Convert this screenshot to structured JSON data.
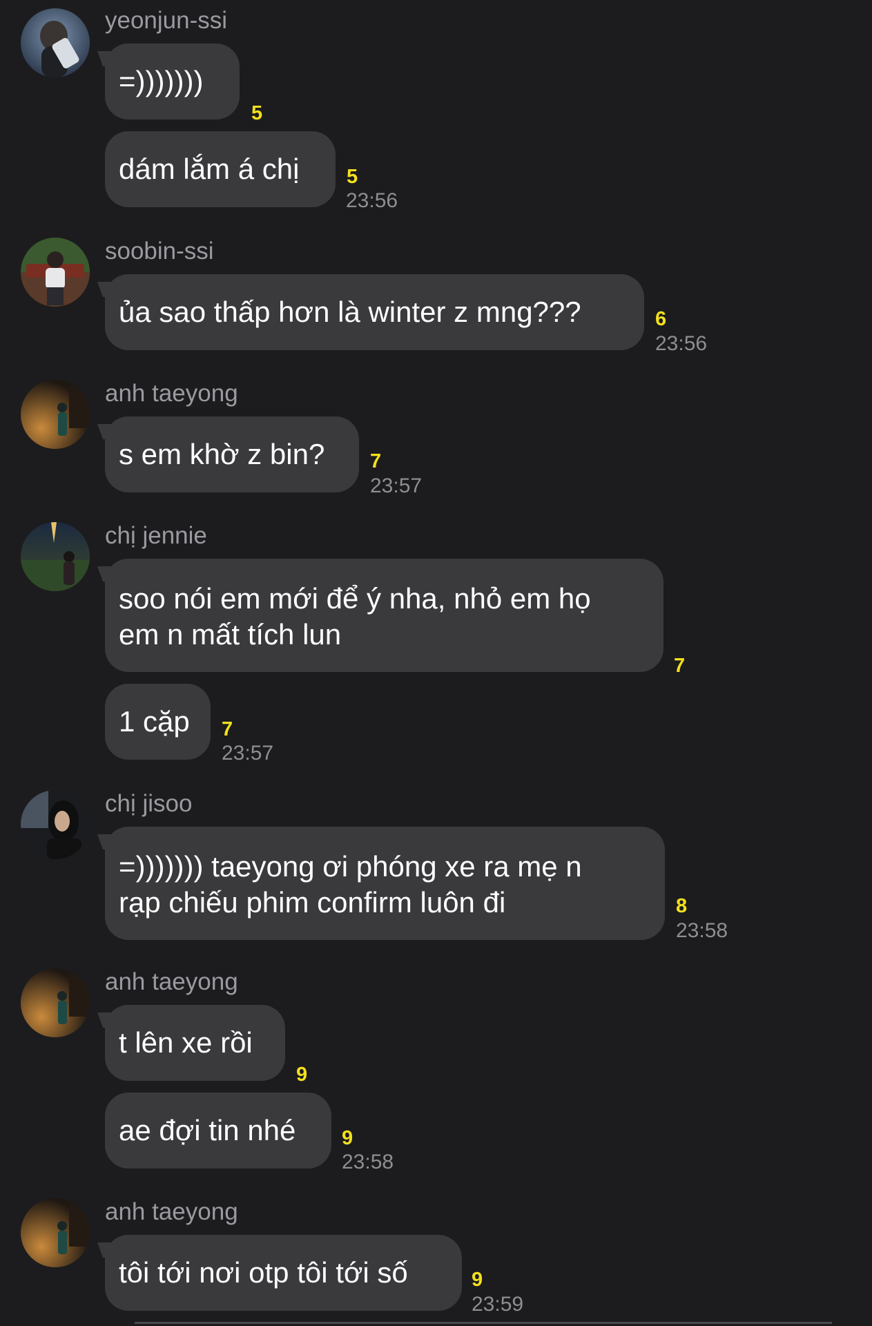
{
  "colors": {
    "background": "#1c1c1e",
    "bubble": "#3a3a3d",
    "read_count": "#f2e01e",
    "time": "#8e8e93",
    "sender": "#9a9aa0"
  },
  "messages": [
    {
      "sender": "yeonjun-ssi",
      "avatar": "avatar-yeonjun",
      "bubbles": [
        {
          "text": "=)))))))",
          "read": "5"
        },
        {
          "text": "dám lắm á chị",
          "read": "5",
          "time": "23:56"
        }
      ]
    },
    {
      "sender": "soobin-ssi",
      "avatar": "avatar-soobin",
      "bubbles": [
        {
          "text": "ủa sao thấp hơn là winter z mng???",
          "read": "6",
          "time": "23:56"
        }
      ]
    },
    {
      "sender": "anh taeyong",
      "avatar": "avatar-taeyong",
      "bubbles": [
        {
          "text": "s em khờ z bin?",
          "read": "7",
          "time": "23:57"
        }
      ]
    },
    {
      "sender": "chị jennie",
      "avatar": "avatar-jennie",
      "bubbles": [
        {
          "line1": "soo nói em mới để ý nha, nhỏ em họ",
          "line2": "em n mất tích lun",
          "read": "7"
        },
        {
          "text": "1 cặp",
          "read": "7",
          "time": "23:57"
        }
      ]
    },
    {
      "sender": "chị jisoo",
      "avatar": "avatar-jisoo",
      "bubbles": [
        {
          "line1": "=))))))) taeyong ơi phóng xe ra mẹ n",
          "line2": "rạp chiếu phim confirm luôn đi",
          "read": "8",
          "time": "23:58"
        }
      ]
    },
    {
      "sender": "anh taeyong",
      "avatar": "avatar-taeyong",
      "bubbles": [
        {
          "text": "t lên xe rồi",
          "read": "9"
        },
        {
          "text": "ae đợi tin nhé",
          "read": "9",
          "time": "23:58"
        }
      ]
    },
    {
      "sender": "anh taeyong",
      "avatar": "avatar-taeyong",
      "bubbles": [
        {
          "text": "tôi tới nơi otp tôi tới số",
          "read": "9",
          "time": "23:59"
        }
      ]
    }
  ]
}
